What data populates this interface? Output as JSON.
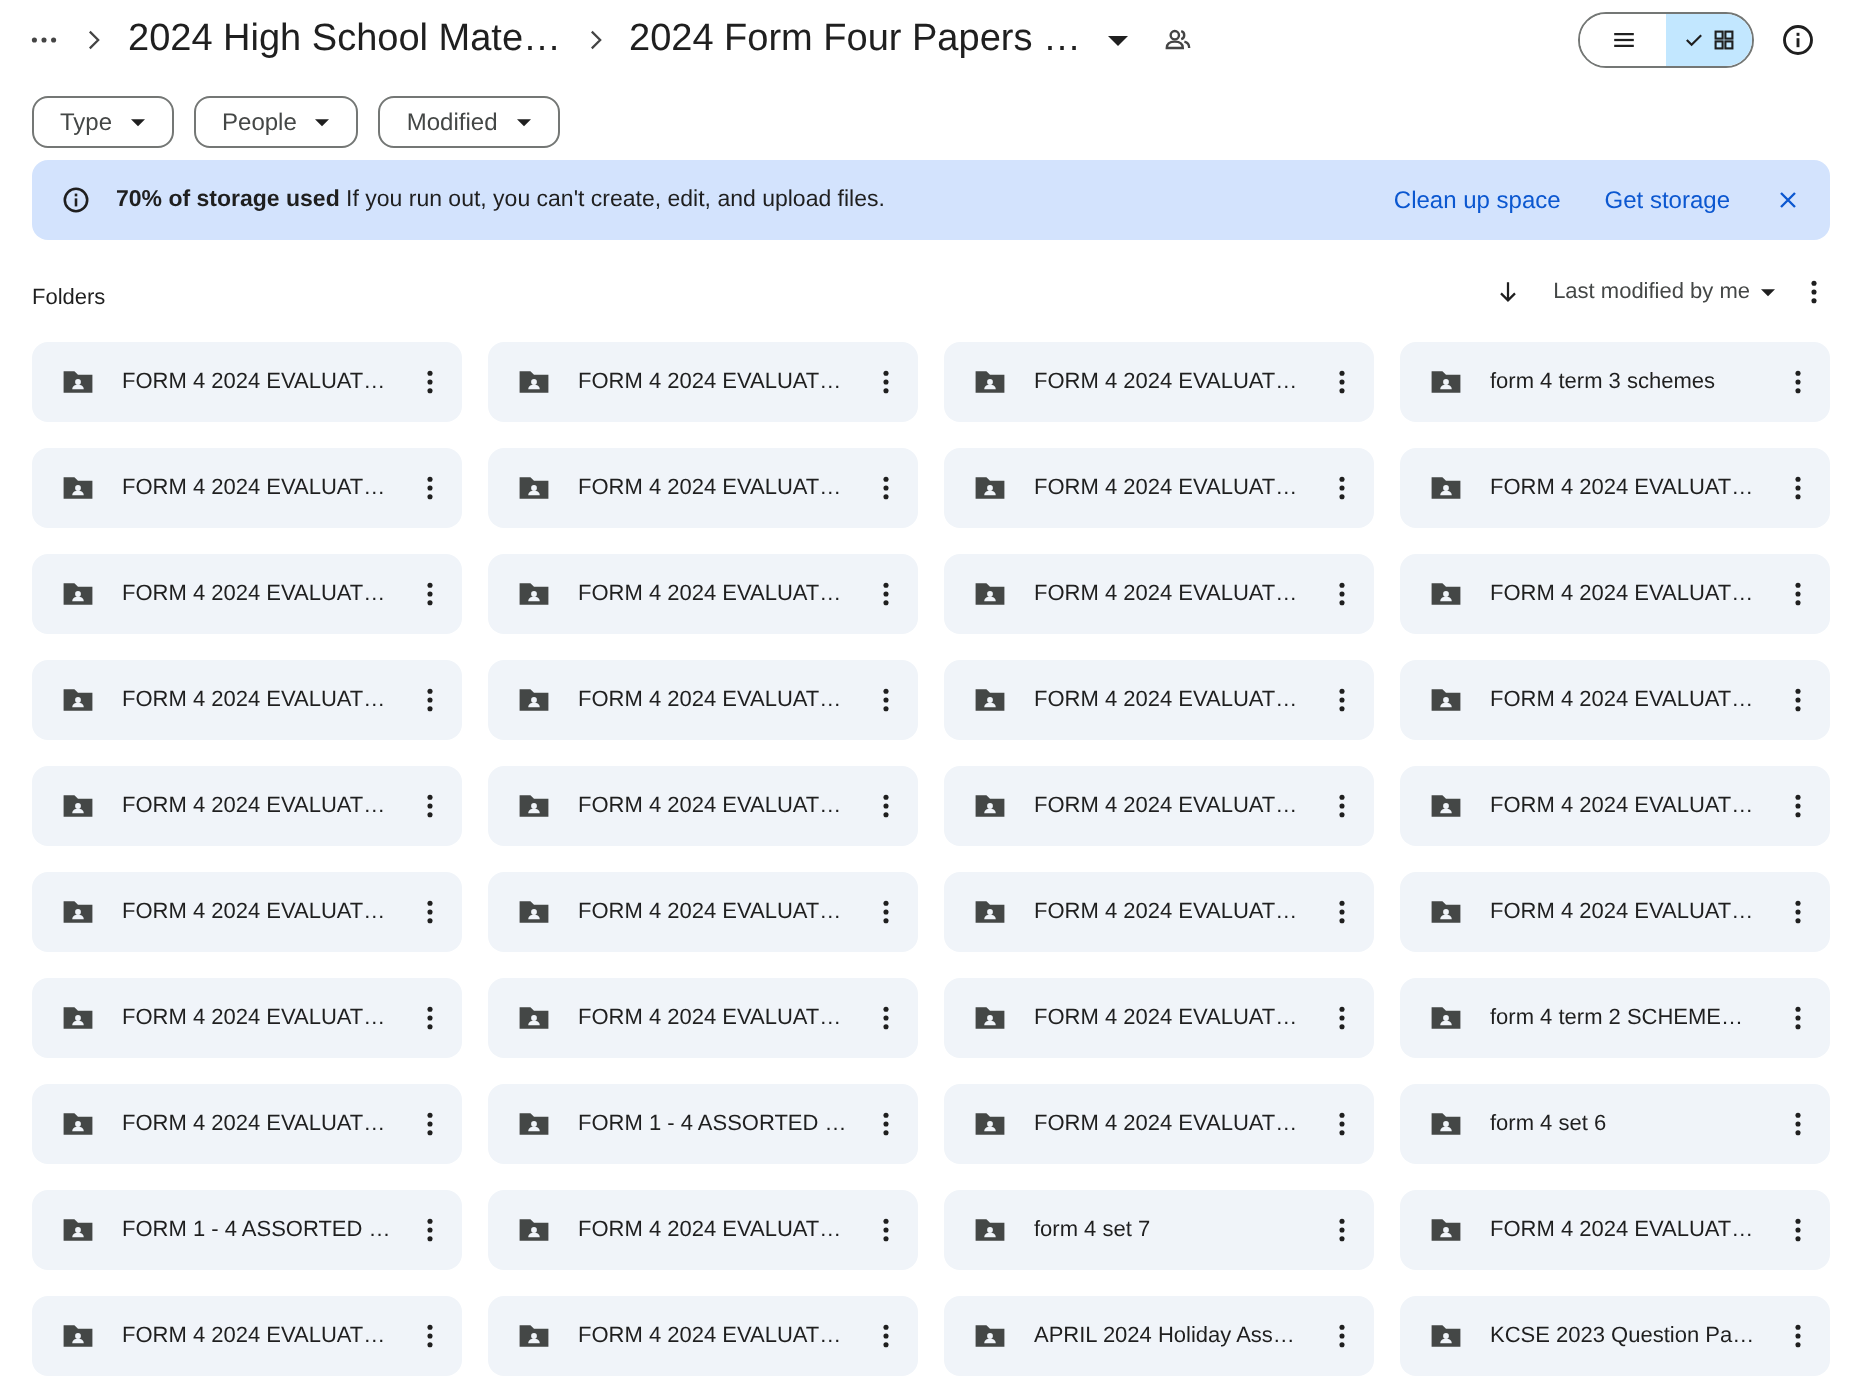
{
  "breadcrumbs": [
    {
      "label": "2024 High School Mate…",
      "kind": "link"
    },
    {
      "label": "2024 Form Four Papers …",
      "kind": "current"
    }
  ],
  "view_toggle": [
    {
      "kind": "list",
      "selected": false
    },
    {
      "kind": "grid",
      "selected": true
    }
  ],
  "filters": [
    "Type",
    "People",
    "Modified"
  ],
  "banner": {
    "text": "**70% of storage used** If you run out, you can't create, edit, and upload files.",
    "actions": [
      "Clean up space",
      "Get storage"
    ]
  },
  "section_title": "Folders",
  "sort": {
    "label": "Last modified by me"
  },
  "folders": [
    "FORM 4 2024 EVALUAT…",
    "FORM 4 2024 EVALUAT…",
    "FORM 4 2024 EVALUAT…",
    "form 4 term 3 schemes",
    "FORM 4 2024 EVALUAT…",
    "FORM 4 2024 EVALUAT…",
    "FORM 4 2024 EVALUAT…",
    "FORM 4 2024 EVALUAT…",
    "FORM 4 2024 EVALUAT…",
    "FORM 4 2024 EVALUAT…",
    "FORM 4 2024 EVALUAT…",
    "FORM 4 2024 EVALUAT…",
    "FORM 4 2024 EVALUAT…",
    "FORM 4 2024 EVALUAT…",
    "FORM 4 2024 EVALUAT…",
    "FORM 4 2024 EVALUAT…",
    "FORM 4 2024 EVALUAT…",
    "FORM 4 2024 EVALUAT…",
    "FORM 4 2024 EVALUAT…",
    "FORM 4 2024 EVALUAT…",
    "FORM 4 2024 EVALUAT…",
    "FORM 4 2024 EVALUAT…",
    "FORM 4 2024 EVALUAT…",
    "FORM 4 2024 EVALUAT…",
    "FORM 4 2024 EVALUAT…",
    "FORM 4 2024 EVALUAT…",
    "FORM 4 2024 EVALUAT…",
    "form 4 term 2 SCHEME…",
    "FORM 4 2024 EVALUAT…",
    "FORM 1 - 4 ASSORTED …",
    "FORM 4 2024 EVALUAT…",
    "form 4 set 6",
    "FORM 1 - 4 ASSORTED …",
    "FORM 4 2024 EVALUAT…",
    "form 4 set 7",
    "FORM 4 2024 EVALUAT…",
    "FORM 4 2024 EVALUAT…",
    "FORM 4 2024 EVALUAT…",
    "APRIL 2024 Holiday Ass…",
    "KCSE 2023 Question Pa…"
  ]
}
